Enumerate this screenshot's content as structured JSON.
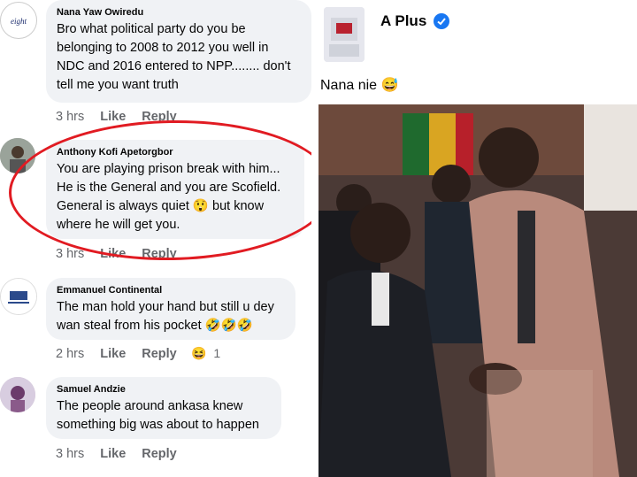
{
  "comments": [
    {
      "name": "Nana Yaw Owiredu",
      "text": [
        "Bro what political party do you be",
        "belonging to 2008 to 2012 you well in",
        "NDC and 2016 entered to NPP........ don't",
        "tell me you want truth"
      ],
      "time": "3 hrs",
      "like": "Like",
      "reply": "Reply"
    },
    {
      "name": "Anthony Kofi Apetorgbor",
      "text": [
        "You are playing prison break with him...",
        "He is the General and you are Scofield.",
        "General is always quiet 😲 but know",
        "where he will get you."
      ],
      "time": "3 hrs",
      "like": "Like",
      "reply": "Reply"
    },
    {
      "name": "Emmanuel Continental",
      "text": [
        "The man hold your hand but still u dey",
        "wan steal from his pocket 🤣🤣🤣"
      ],
      "time": "2 hrs",
      "like": "Like",
      "reply": "Reply",
      "reaction_emoji": "😆",
      "reaction_count": "1"
    },
    {
      "name": "Samuel Andzie",
      "text": [
        "The people around ankasa knew",
        "something big was about to happen"
      ],
      "time": "3 hrs",
      "like": "Like",
      "reply": "Reply"
    }
  ],
  "post": {
    "author": "A Plus",
    "caption": "Nana nie 😅",
    "verified_color": "#1877f2"
  },
  "colors": {
    "bubble": "#f0f2f5",
    "meta": "#65676b",
    "circle": "#e11b22"
  },
  "icons": {
    "verified": "verified-badge-icon"
  }
}
